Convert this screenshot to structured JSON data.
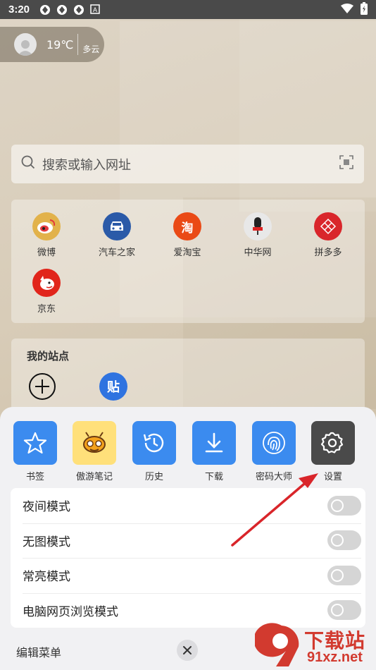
{
  "status_bar": {
    "time": "3:20"
  },
  "weather": {
    "temperature": "19℃",
    "condition": "多云"
  },
  "search": {
    "placeholder": "搜索或输入网址"
  },
  "quick_sites": [
    {
      "label": "微博",
      "icon": "weibo-icon",
      "color": "#e2b24a"
    },
    {
      "label": "汽车之家",
      "icon": "car-icon",
      "color": "#2b5aa8"
    },
    {
      "label": "爱淘宝",
      "icon": "taobao-icon",
      "color": "#ea4a16",
      "glyph": "淘"
    },
    {
      "label": "中华网",
      "icon": "microphone-icon",
      "color": "#e8e8e8"
    },
    {
      "label": "拼多多",
      "icon": "pinduoduo-icon",
      "color": "#d9262b"
    },
    {
      "label": "京东",
      "icon": "jd-dog-icon",
      "color": "#e1251b"
    }
  ],
  "my_sites": {
    "title": "我的站点",
    "tieba_glyph": "贴"
  },
  "menu": [
    {
      "label": "书签",
      "icon": "star-icon",
      "color": "#3b8bef"
    },
    {
      "label": "傲游笔记",
      "icon": "bee-icon",
      "color": "#ffe07a"
    },
    {
      "label": "历史",
      "icon": "history-icon",
      "color": "#3b8bef"
    },
    {
      "label": "下载",
      "icon": "download-icon",
      "color": "#3b8bef"
    },
    {
      "label": "密码大师",
      "icon": "fingerprint-icon",
      "color": "#3b8bef"
    },
    {
      "label": "设置",
      "icon": "gear-icon",
      "color": "#4a4a4a"
    }
  ],
  "toggles": [
    {
      "label": "夜间模式",
      "on": false
    },
    {
      "label": "无图模式",
      "on": false
    },
    {
      "label": "常亮模式",
      "on": false
    },
    {
      "label": "电脑网页浏览模式",
      "on": false
    }
  ],
  "footer": {
    "edit_menu": "编辑菜单"
  },
  "watermark": {
    "brand": "下载站",
    "domain": "91xz.net",
    "mark": "9"
  },
  "colors": {
    "arrow": "#d9252a",
    "accent": "#3b8bef"
  }
}
